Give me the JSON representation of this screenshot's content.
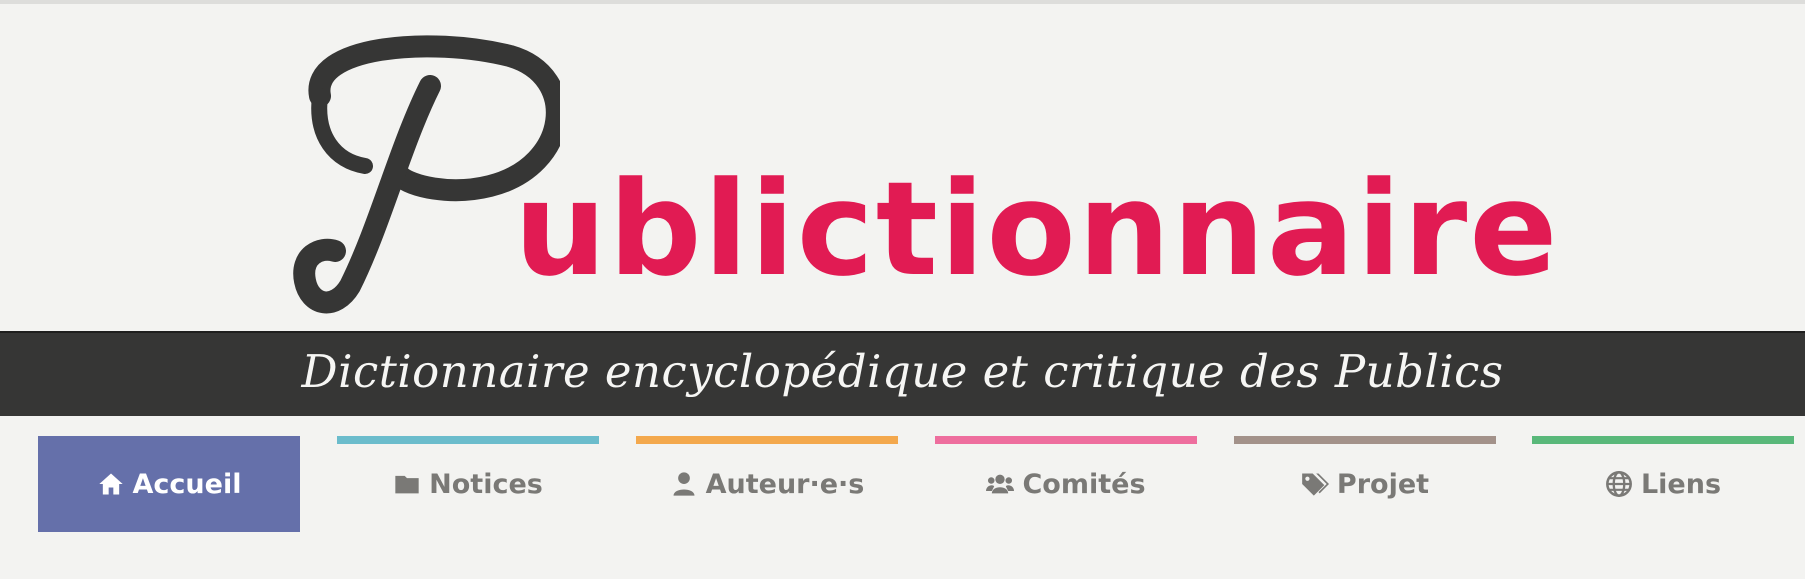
{
  "site": {
    "logo_word": "ublictionnaire",
    "tagline": "Dictionnaire encyclopédique et critique des Publics",
    "colors": {
      "brand_pink": "#e11b53",
      "dark": "#363635",
      "background": "#f3f3f1"
    }
  },
  "nav": {
    "items": [
      {
        "label": "Accueil",
        "icon": "home-icon",
        "accent": "#6570aa",
        "active": true
      },
      {
        "label": "Notices",
        "icon": "folder-icon",
        "accent": "#6bbccc",
        "active": false
      },
      {
        "label": "Auteur·e·s",
        "icon": "user-icon",
        "accent": "#f3a84d",
        "active": false
      },
      {
        "label": "Comités",
        "icon": "users-icon",
        "accent": "#ee6e9e",
        "active": false
      },
      {
        "label": "Projet",
        "icon": "tags-icon",
        "accent": "#a3928a",
        "active": false
      },
      {
        "label": "Liens",
        "icon": "globe-icon",
        "accent": "#59b87a",
        "active": false
      }
    ]
  }
}
